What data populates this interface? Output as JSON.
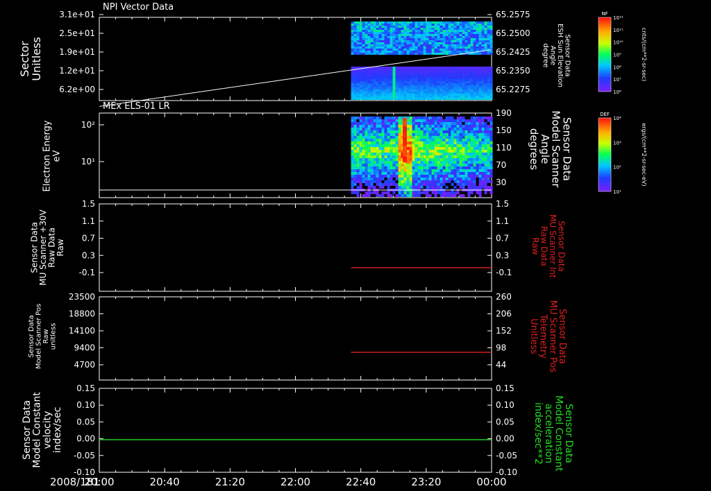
{
  "time_axis": {
    "date": "2008/181",
    "ticks": [
      "20:00",
      "20:40",
      "21:20",
      "22:00",
      "22:40",
      "23:20",
      "00:00"
    ]
  },
  "colorbars": [
    {
      "tag": "NF",
      "top_label": "10¹²",
      "bottom_label": "10⁶",
      "intermediate": [
        "10¹¹",
        "10¹⁰",
        "10⁹",
        "10⁸",
        "10⁷"
      ],
      "unit": "cnts/(cm**2-sr-sec)"
    },
    {
      "tag": "DEF",
      "top_label": "10⁴",
      "bottom_label": "10¹",
      "intermediate": [
        "10³",
        "10²"
      ],
      "unit": "ergs/(cm**2-sr-sec-eV)"
    }
  ],
  "colors": {
    "line_white": "#ffffff",
    "line_red": "#cc2222",
    "line_green": "#22cc22",
    "axis": "#ffffff"
  },
  "chart_data": [
    {
      "type": "heatmap",
      "title": "NPI Vector Data",
      "left_ylabel": [
        "Sector",
        "Unitless"
      ],
      "left_ticks": [
        "3.1e+01",
        "2.5e+01",
        "1.9e+01",
        "1.2e+01",
        "6.2e+00"
      ],
      "right_ylabel": [
        "Sensor Data",
        "ESH Sun Elevation",
        "Angle",
        "degree"
      ],
      "right_ticks": [
        "65.2575",
        "65.2500",
        "65.2425",
        "65.2350",
        "65.2275"
      ],
      "overlay_line": {
        "x": [
          "20:00",
          "00:00"
        ],
        "y": [
          65.2205,
          65.243
        ]
      },
      "data_start": "22:34",
      "colorbar": "NF"
    },
    {
      "type": "heatmap",
      "title": "MEx ELS-01 LR",
      "left_ylabel": [
        "Electron Energy",
        "eV"
      ],
      "left_ticks": [
        "10²",
        "10¹"
      ],
      "right_ylabel": [
        "Sensor Data",
        "Model Scanner",
        "Angle",
        "degrees"
      ],
      "right_ticks": [
        "190",
        "150",
        "110",
        "70",
        "30"
      ],
      "overlay_line": {
        "x": [
          "20:00",
          "00:00"
        ],
        "y": [
          13,
          13
        ]
      },
      "data_start": "22:34",
      "colorbar": "DEF"
    },
    {
      "type": "line",
      "left_ylabel": [
        "Sensor Data",
        "MU Scanner +30V",
        "Raw Data",
        "Raw"
      ],
      "left_ticks": [
        "1.5",
        "1.1",
        "0.7",
        "0.3",
        "-0.1"
      ],
      "right_ylabel": [
        "Sensor Data",
        "MU Scanner Int",
        "Raw Data",
        "Raw"
      ],
      "right_ticks": [
        "1.5",
        "1.1",
        "0.7",
        "0.3",
        "-0.1"
      ],
      "ylim": [
        -0.5,
        1.5
      ],
      "series": [
        {
          "x": [
            "22:34",
            "00:00"
          ],
          "y": [
            0.0,
            0.0
          ]
        }
      ]
    },
    {
      "type": "line",
      "left_ylabel": [
        "Sensor Data",
        "Model Scanner Pos",
        "Raw",
        "unitless"
      ],
      "left_ticks": [
        "23500",
        "18800",
        "14100",
        "9400",
        "4700"
      ],
      "right_ylabel": [
        "Sensor Data",
        "MU Scanner Pos",
        "Telemetry",
        "Unitless"
      ],
      "right_ticks": [
        "260",
        "206",
        "152",
        "98",
        "44"
      ],
      "ylim": [
        0,
        23500
      ],
      "series": [
        {
          "x": [
            "22:34",
            "00:00"
          ],
          "y": [
            8000,
            8000
          ]
        }
      ]
    },
    {
      "type": "line",
      "left_ylabel": [
        "Sensor Data",
        "Model Constant",
        "velocity",
        "index/sec"
      ],
      "left_ticks": [
        "0.15",
        "0.10",
        "0.05",
        "0.00",
        "-0.05",
        "-0.10"
      ],
      "right_ylabel": [
        "Sensor Data",
        "Model Constant",
        "acceleration",
        "index/sec**2"
      ],
      "right_ticks": [
        "0.15",
        "0.10",
        "0.05",
        "0.00",
        "-0.05",
        "-0.10"
      ],
      "ylim": [
        -0.1,
        0.15
      ],
      "series": [
        {
          "x": [
            "20:00",
            "00:00"
          ],
          "y": [
            0.0,
            0.0
          ]
        }
      ]
    }
  ]
}
